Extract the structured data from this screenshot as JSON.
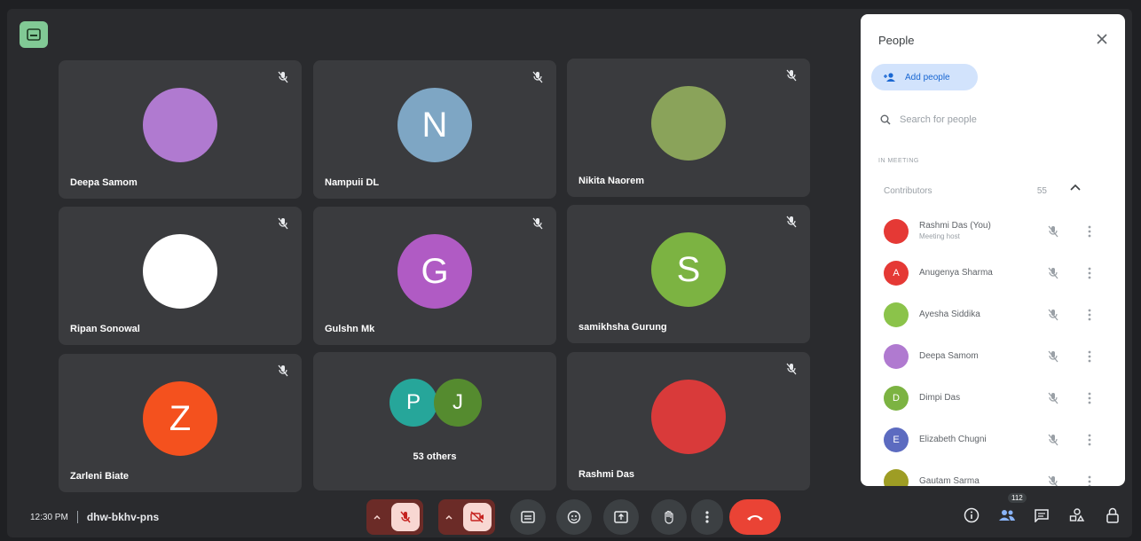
{
  "meeting": {
    "time": "12:30 PM",
    "code": "dhw-bkhv-pns"
  },
  "tiles": [
    {
      "name": "Deepa Samom",
      "avatar_color": "#b07ad0"
    },
    {
      "name": "Nampuii DL",
      "initial": "N",
      "avatar_color": "#7ea6c4"
    },
    {
      "name": "Nikita Naorem",
      "avatar_color": "#8aa35a"
    },
    {
      "name": "Ripan Sonowal",
      "avatar_color": "#ffffff"
    },
    {
      "name": "Gulshn Mk",
      "initial": "G",
      "avatar_color": "#b05bc4"
    },
    {
      "name": "samikhsha Gurung",
      "initial": "S",
      "avatar_color": "#7cb342"
    },
    {
      "name": "Zarleni Biate",
      "initial": "Z",
      "avatar_color": "#f4511e"
    },
    {
      "name": "53 others",
      "others": [
        {
          "initial": "P",
          "color": "#26a69a"
        },
        {
          "initial": "J",
          "color": "#558b2f"
        }
      ]
    },
    {
      "name": "Rashmi Das",
      "avatar_color": "#d93a3a"
    }
  ],
  "panel": {
    "title": "People",
    "add_label": "Add people",
    "search_placeholder": "Search for people",
    "section_label": "IN MEETING",
    "contributors_label": "Contributors",
    "contributors_count": "55",
    "people": [
      {
        "name": "Rashmi Das (You)",
        "sub": "Meeting host",
        "color": "#e53935",
        "initial": ""
      },
      {
        "name": "Anugenya Sharma",
        "color": "#e53935",
        "initial": "A"
      },
      {
        "name": "Ayesha Siddika",
        "color": "#8bc34a",
        "initial": ""
      },
      {
        "name": "Deepa Samom",
        "color": "#b07ad0",
        "initial": ""
      },
      {
        "name": "Dimpi Das",
        "color": "#7cb342",
        "initial": "D"
      },
      {
        "name": "Elizabeth Chugni",
        "color": "#5c6bc0",
        "initial": "E"
      },
      {
        "name": "Gautam Sarma",
        "color": "#9e9d24",
        "initial": ""
      }
    ]
  },
  "controls": {
    "participants_count": "112"
  },
  "colors": {
    "end_call": "#ea4335",
    "accent": "#1967d2"
  }
}
